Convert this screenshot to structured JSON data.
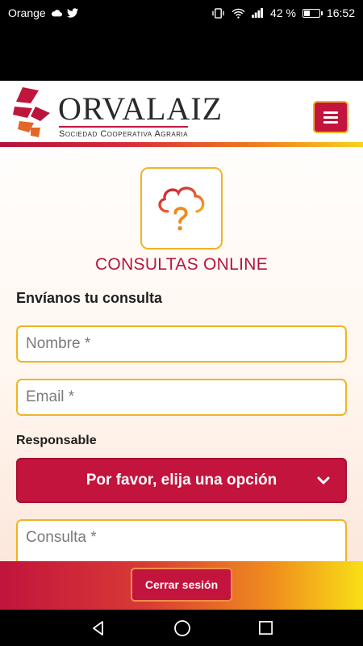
{
  "status_bar": {
    "carrier": "Orange",
    "battery_percent": "42 %",
    "battery_level": 0.42,
    "time": "16:52",
    "icons": [
      "cloud-icon",
      "twitter-icon",
      "vibrate-icon",
      "wifi-icon",
      "signal-icon",
      "battery-icon"
    ]
  },
  "header": {
    "brand_name": "ORVALAIZ",
    "brand_tagline": "Sociedad Cooperativa Agraria",
    "menu_icon": "hamburger-icon"
  },
  "hero": {
    "icon": "cloud-question-icon",
    "title": "CONSULTAS ONLINE"
  },
  "form": {
    "heading": "Envíanos tu consulta",
    "name_placeholder": "Nombre *",
    "email_placeholder": "Email *",
    "responsable_label": "Responsable",
    "responsable_selected": "Por favor, elija una opción",
    "consulta_placeholder": "Consulta *"
  },
  "footer": {
    "logout_label": "Cerrar sesión"
  },
  "nav": {
    "icons": [
      "back-icon",
      "home-icon",
      "recents-icon"
    ]
  },
  "colors": {
    "brand_red": "#c2143c",
    "accent_gold": "#f3b324"
  }
}
